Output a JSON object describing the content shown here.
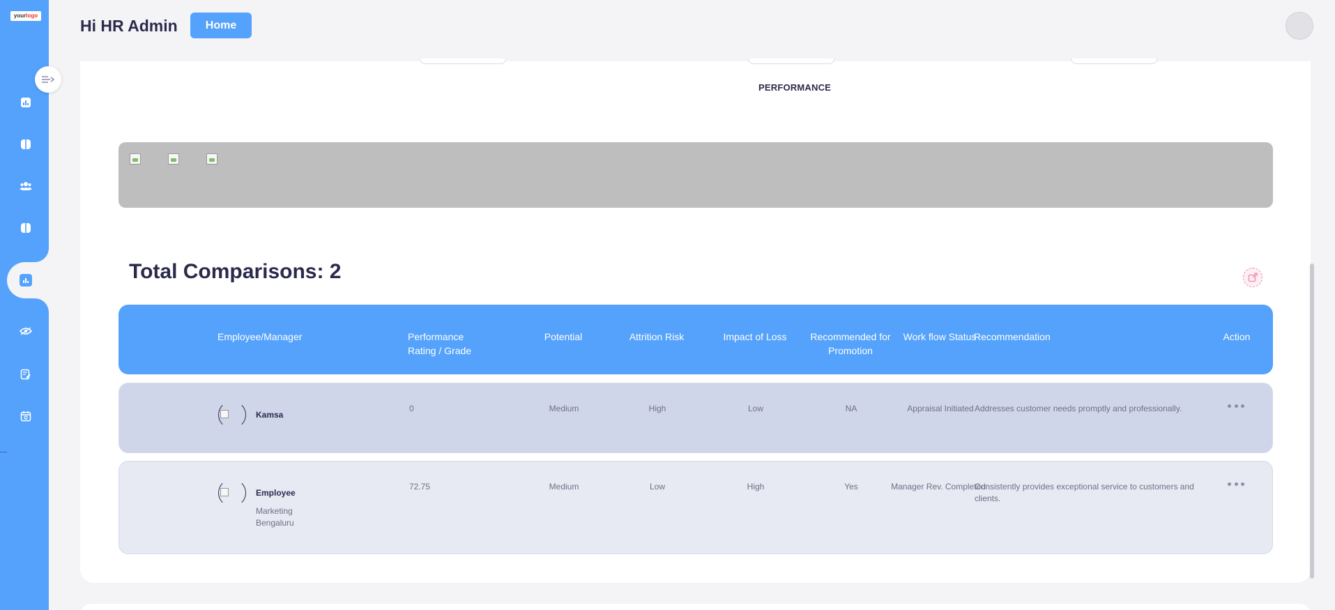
{
  "logo": {
    "text_main": "your",
    "text_accent": "logo"
  },
  "header": {
    "greeting": "Hi HR Admin",
    "home_button": "Home"
  },
  "sidebar": {
    "items": [
      {
        "icon": "bar-chart-icon"
      },
      {
        "icon": "panels-icon"
      },
      {
        "icon": "users-icon"
      },
      {
        "icon": "columns-icon"
      },
      {
        "icon": "analytics-icon",
        "active": true
      },
      {
        "icon": "eye-icon"
      },
      {
        "icon": "edit-document-icon"
      },
      {
        "icon": "calendar-icon"
      }
    ]
  },
  "section": {
    "performance_label": "PERFORMANCE",
    "total_comparisons": "Total Comparisons: 2"
  },
  "table": {
    "headers": {
      "employee": "Employee/Manager",
      "performance_line1": "Performance",
      "performance_line2": "Rating / Grade",
      "potential": "Potential",
      "attrition": "Attrition Risk",
      "impact": "Impact of Loss",
      "promotion_line1": "Recommended for",
      "promotion_line2": "Promotion",
      "workflow": "Work flow Status",
      "recommendation": "Recommendation",
      "action": "Action"
    },
    "rows": [
      {
        "name": "Kamsa",
        "department": "",
        "location": "",
        "rating": "0",
        "potential": "Medium",
        "attrition": "High",
        "impact": "Low",
        "promotion": "NA",
        "workflow": "Appraisal Initiated",
        "recommendation": "Addresses customer needs promptly and professionally."
      },
      {
        "name": "Employee",
        "department": "Marketing",
        "location": "Bengaluru",
        "rating": "72.75",
        "potential": "Medium",
        "attrition": "Low",
        "impact": "High",
        "promotion": "Yes",
        "workflow": "Manager Rev. Completed",
        "recommendation": "Consistently provides exceptional service to customers and clients."
      }
    ]
  },
  "colors": {
    "primary": "#54a2fb",
    "text_dark": "#2b2a4c",
    "row1_bg": "#d0d6ea",
    "row2_bg": "#e7e9f3"
  }
}
